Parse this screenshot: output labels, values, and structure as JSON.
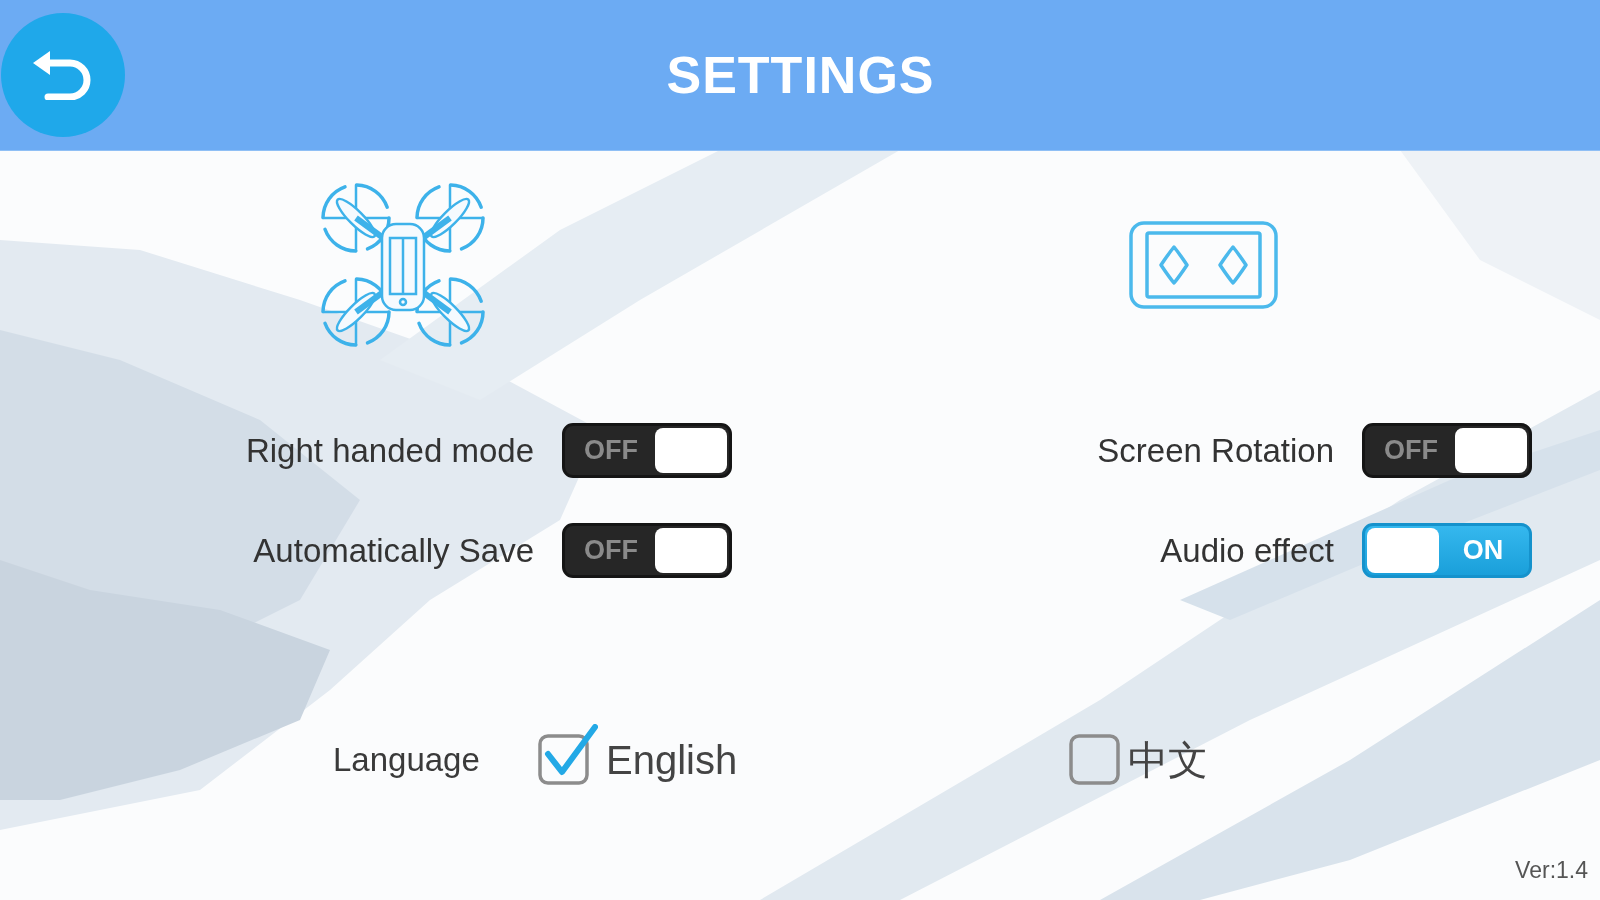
{
  "header": {
    "title": "SETTINGS"
  },
  "panels": [
    {
      "kind": "drone",
      "settings": [
        {
          "label": "Right handed mode",
          "state_label": "OFF",
          "on": false
        },
        {
          "label": "Automatically Save",
          "state_label": "OFF",
          "on": false
        }
      ]
    },
    {
      "kind": "controller",
      "settings": [
        {
          "label": "Screen Rotation",
          "state_label": "OFF",
          "on": false
        },
        {
          "label": "Audio effect",
          "state_label": "ON",
          "on": true
        }
      ]
    }
  ],
  "language": {
    "label": "Language",
    "options": [
      {
        "label": "English",
        "selected": true
      },
      {
        "label": "中文",
        "selected": false
      }
    ]
  },
  "version": "Ver:1.4"
}
